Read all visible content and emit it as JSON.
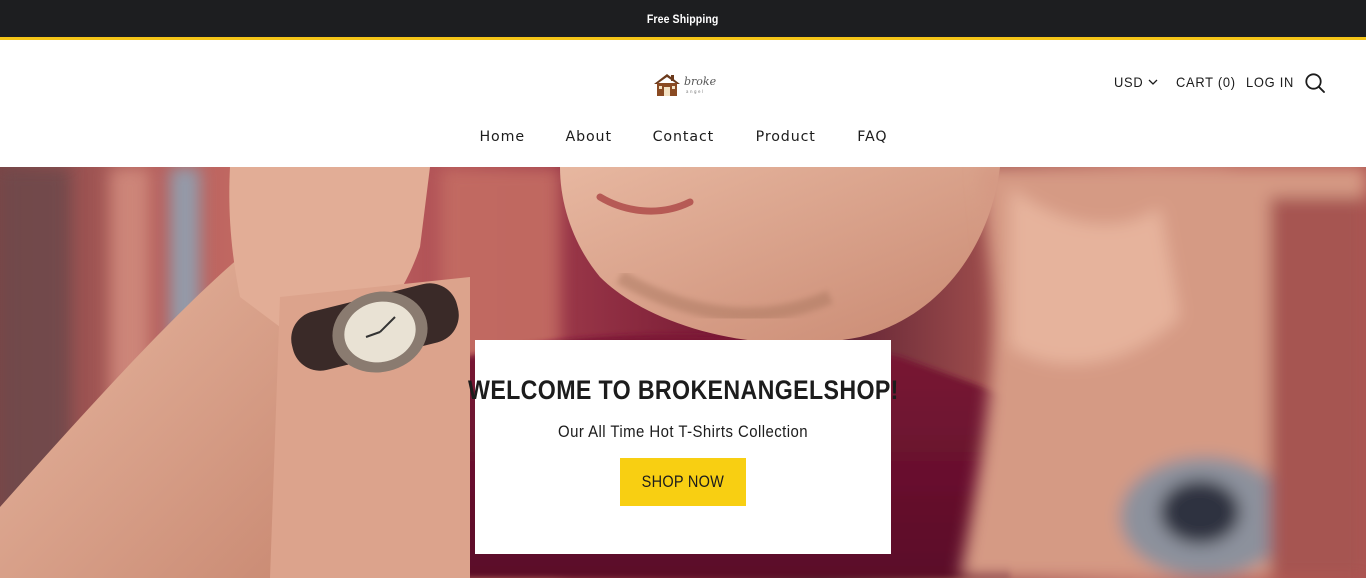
{
  "announcement": {
    "text": "Free Shipping"
  },
  "header": {
    "logo": {
      "word": "broke",
      "sub": "angel"
    },
    "currency": "USD",
    "cart_label": "CART (0)",
    "login_label": "LOG IN"
  },
  "nav": {
    "items": [
      {
        "label": "Home"
      },
      {
        "label": "About"
      },
      {
        "label": "Contact"
      },
      {
        "label": "Product"
      },
      {
        "label": "FAQ"
      }
    ]
  },
  "hero": {
    "title": "WELCOME TO BROKENANGELSHOP!",
    "subtitle": "Our All Time Hot T-Shirts Collection",
    "cta_label": "SHOP NOW"
  },
  "colors": {
    "announcement_bg": "#1d1e20",
    "accent": "#f8cf12",
    "text": "#1c1c1c"
  }
}
